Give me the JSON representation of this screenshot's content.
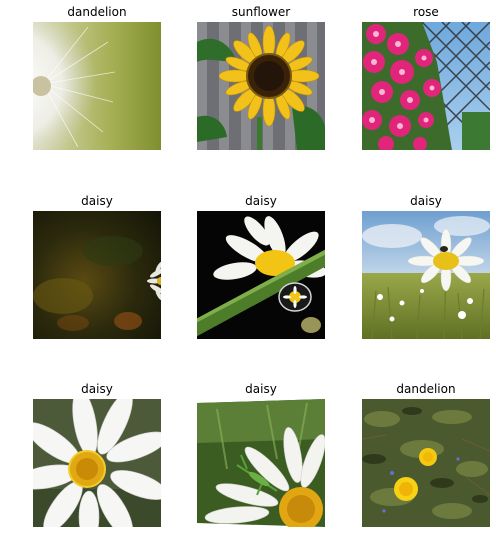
{
  "grid": {
    "images": [
      {
        "label": "dandelion",
        "subject": "dandelion seed head"
      },
      {
        "label": "sunflower",
        "subject": "sunflower"
      },
      {
        "label": "rose",
        "subject": "pink roses by fence"
      },
      {
        "label": "daisy",
        "subject": "dark blurry daisy"
      },
      {
        "label": "daisy",
        "subject": "daisy with stem and water drop"
      },
      {
        "label": "daisy",
        "subject": "daisy in meadow"
      },
      {
        "label": "daisy",
        "subject": "daisy close-up"
      },
      {
        "label": "daisy",
        "subject": "daisy with grasshopper"
      },
      {
        "label": "dandelion",
        "subject": "dandelions in grass"
      }
    ]
  }
}
